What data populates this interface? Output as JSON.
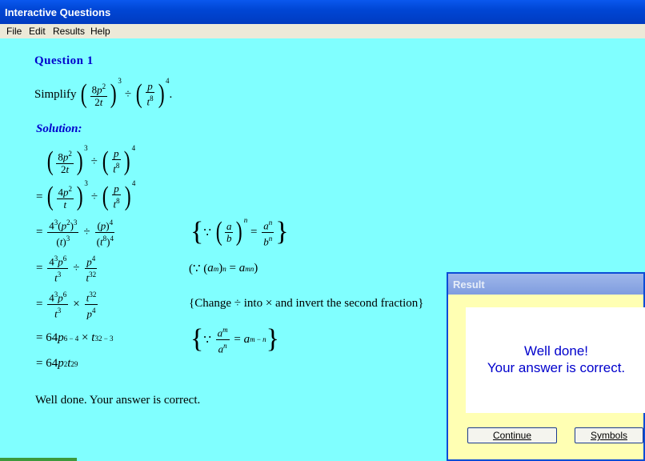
{
  "window": {
    "title": "Interactive Questions"
  },
  "menu": [
    "File",
    "Edit",
    "Results",
    "Help"
  ],
  "question": {
    "heading": "Question 1",
    "prompt": "Simplify"
  },
  "solution": {
    "heading": "Solution:"
  },
  "feedback": "Well done.  Your answer is correct.",
  "reasons": {
    "r4": "(∵ (a",
    "r4b": ")",
    "r5": "{Change ÷ into × and invert the second fraction}"
  },
  "dialog": {
    "title": "Result",
    "line1": "Well done!",
    "line2": "Your answer is correct.",
    "continue": "Continue",
    "symbols": "Symbols"
  }
}
